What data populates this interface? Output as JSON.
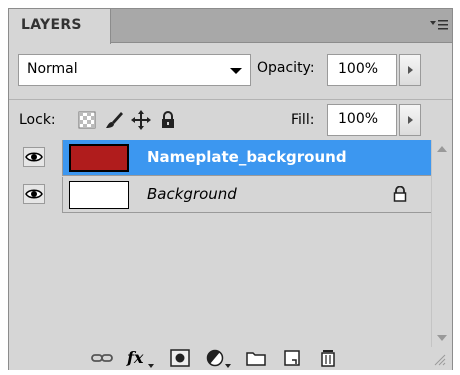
{
  "panel": {
    "tab_label": "LAYERS"
  },
  "blend": {
    "mode": "Normal",
    "opacity_label": "Opacity:",
    "opacity_value": "100%"
  },
  "lock": {
    "label": "Lock:",
    "fill_label": "Fill:",
    "fill_value": "100%"
  },
  "layers": [
    {
      "name": "Nameplate_background",
      "selected": true,
      "thumb_color": "#b01c1c",
      "visible": true,
      "locked": false
    },
    {
      "name": "Background",
      "selected": false,
      "thumb_color": "#ffffff",
      "visible": true,
      "locked": true
    }
  ],
  "colors": {
    "selection": "#3c97f0",
    "panel_bg": "#d6d6d6"
  },
  "icons": {
    "panel_menu": "panel-menu-icon",
    "lock_transparent": "lock-transparent-pixels-icon",
    "lock_image": "lock-image-pixels-icon",
    "lock_position": "lock-position-icon",
    "lock_all": "lock-all-icon",
    "bottom": [
      "link-layers-icon",
      "fx-icon",
      "add-mask-icon",
      "adjustment-layer-icon",
      "new-group-icon",
      "new-layer-icon",
      "trash-icon"
    ]
  }
}
